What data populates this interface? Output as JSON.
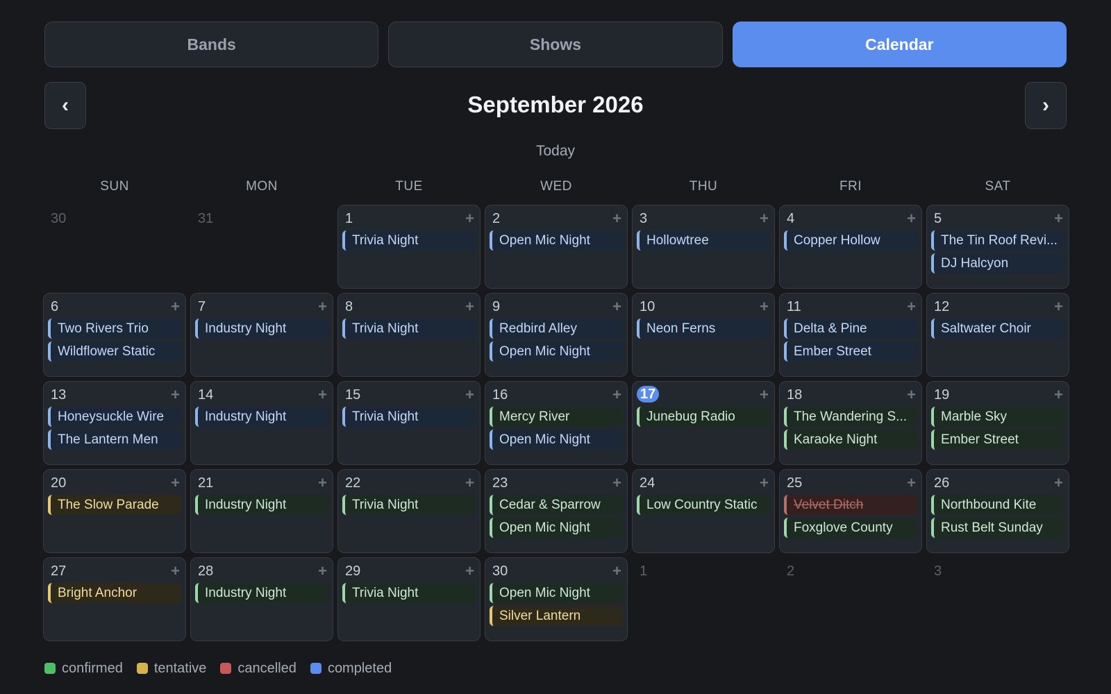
{
  "colors": {
    "accent": "#5b8def",
    "confirmed": "#4fbf67",
    "tentative": "#d4b44a",
    "cancelled": "#c65a57",
    "completed": "#5b8def"
  },
  "tabs": [
    {
      "label": "Bands",
      "active": false
    },
    {
      "label": "Shows",
      "active": false
    },
    {
      "label": "Calendar",
      "active": true
    }
  ],
  "calendar": {
    "prev_label": "‹",
    "next_label": "›",
    "month_title": "September 2026",
    "today_label": "Today",
    "weekdays": [
      "SUN",
      "MON",
      "TUE",
      "WED",
      "THU",
      "FRI",
      "SAT"
    ],
    "add_label": "+",
    "days": [
      {
        "num": "30",
        "outside": true,
        "events": []
      },
      {
        "num": "31",
        "outside": true,
        "events": []
      },
      {
        "num": "1",
        "events": [
          {
            "name": "Trivia Night",
            "status": "completed"
          }
        ]
      },
      {
        "num": "2",
        "events": [
          {
            "name": "Open Mic Night",
            "status": "completed"
          }
        ]
      },
      {
        "num": "3",
        "events": [
          {
            "name": "Hollowtree",
            "status": "completed"
          }
        ]
      },
      {
        "num": "4",
        "events": [
          {
            "name": "Copper Hollow",
            "status": "completed"
          }
        ]
      },
      {
        "num": "5",
        "events": [
          {
            "name": "The Tin Roof Revi...",
            "status": "completed"
          },
          {
            "name": "DJ Halcyon",
            "status": "completed"
          }
        ]
      },
      {
        "num": "6",
        "events": [
          {
            "name": "Two Rivers Trio",
            "status": "completed"
          },
          {
            "name": "Wildflower Static",
            "status": "completed"
          }
        ]
      },
      {
        "num": "7",
        "events": [
          {
            "name": "Industry Night",
            "status": "completed"
          }
        ]
      },
      {
        "num": "8",
        "events": [
          {
            "name": "Trivia Night",
            "status": "completed"
          }
        ]
      },
      {
        "num": "9",
        "events": [
          {
            "name": "Redbird Alley",
            "status": "completed"
          },
          {
            "name": "Open Mic Night",
            "status": "completed"
          }
        ]
      },
      {
        "num": "10",
        "events": [
          {
            "name": "Neon Ferns",
            "status": "completed"
          }
        ]
      },
      {
        "num": "11",
        "events": [
          {
            "name": "Delta & Pine",
            "status": "completed"
          },
          {
            "name": "Ember Street",
            "status": "completed"
          }
        ]
      },
      {
        "num": "12",
        "events": [
          {
            "name": "Saltwater Choir",
            "status": "completed"
          }
        ]
      },
      {
        "num": "13",
        "events": [
          {
            "name": "Honeysuckle Wire",
            "status": "completed"
          },
          {
            "name": "The Lantern Men",
            "status": "completed"
          }
        ]
      },
      {
        "num": "14",
        "events": [
          {
            "name": "Industry Night",
            "status": "completed"
          }
        ]
      },
      {
        "num": "15",
        "events": [
          {
            "name": "Trivia Night",
            "status": "completed"
          }
        ]
      },
      {
        "num": "16",
        "events": [
          {
            "name": "Mercy River",
            "status": "confirmed"
          },
          {
            "name": "Open Mic Night",
            "status": "completed"
          }
        ]
      },
      {
        "num": "17",
        "today": true,
        "events": [
          {
            "name": "Junebug Radio",
            "status": "confirmed"
          }
        ]
      },
      {
        "num": "18",
        "events": [
          {
            "name": "The Wandering S...",
            "status": "confirmed"
          },
          {
            "name": "Karaoke Night",
            "status": "confirmed"
          }
        ]
      },
      {
        "num": "19",
        "events": [
          {
            "name": "Marble Sky",
            "status": "confirmed"
          },
          {
            "name": "Ember Street",
            "status": "confirmed"
          }
        ]
      },
      {
        "num": "20",
        "events": [
          {
            "name": "The Slow Parade",
            "status": "tentative"
          }
        ]
      },
      {
        "num": "21",
        "events": [
          {
            "name": "Industry Night",
            "status": "confirmed"
          }
        ]
      },
      {
        "num": "22",
        "events": [
          {
            "name": "Trivia Night",
            "status": "confirmed"
          }
        ]
      },
      {
        "num": "23",
        "events": [
          {
            "name": "Cedar & Sparrow",
            "status": "confirmed"
          },
          {
            "name": "Open Mic Night",
            "status": "confirmed"
          }
        ]
      },
      {
        "num": "24",
        "events": [
          {
            "name": "Low Country Static",
            "status": "confirmed"
          }
        ]
      },
      {
        "num": "25",
        "events": [
          {
            "name": "Velvet Ditch",
            "status": "cancelled"
          },
          {
            "name": "Foxglove County",
            "status": "confirmed"
          }
        ]
      },
      {
        "num": "26",
        "events": [
          {
            "name": "Northbound Kite",
            "status": "confirmed"
          },
          {
            "name": "Rust Belt Sunday",
            "status": "confirmed"
          }
        ]
      },
      {
        "num": "27",
        "events": [
          {
            "name": "Bright Anchor",
            "status": "tentative"
          }
        ]
      },
      {
        "num": "28",
        "events": [
          {
            "name": "Industry Night",
            "status": "confirmed"
          }
        ]
      },
      {
        "num": "29",
        "events": [
          {
            "name": "Trivia Night",
            "status": "confirmed"
          }
        ]
      },
      {
        "num": "30",
        "events": [
          {
            "name": "Open Mic Night",
            "status": "confirmed"
          },
          {
            "name": "Silver Lantern",
            "status": "tentative"
          }
        ]
      },
      {
        "num": "1",
        "outside": true,
        "events": []
      },
      {
        "num": "2",
        "outside": true,
        "events": []
      },
      {
        "num": "3",
        "outside": true,
        "events": []
      }
    ]
  },
  "legend": [
    {
      "label": "confirmed",
      "color": "#4fbf67"
    },
    {
      "label": "tentative",
      "color": "#d4b44a"
    },
    {
      "label": "cancelled",
      "color": "#c65a57"
    },
    {
      "label": "completed",
      "color": "#5b8def"
    }
  ]
}
